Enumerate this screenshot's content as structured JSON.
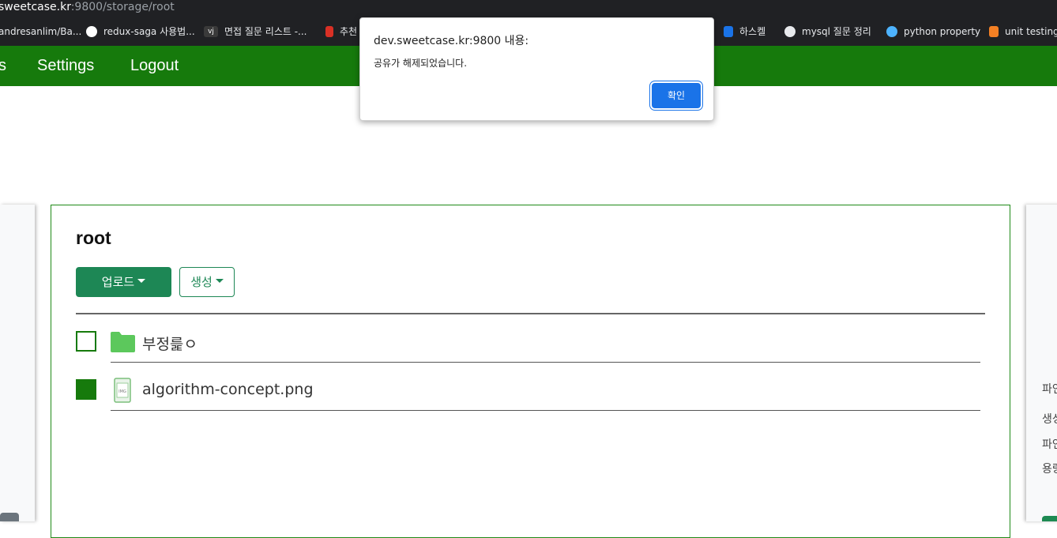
{
  "browser": {
    "url_host": "sweetcase.kr",
    "url_path": ":9800/storage/root",
    "bookmarks": [
      {
        "label": "andresanlim/Ba...",
        "icon": "github-icon",
        "color": "#202124"
      },
      {
        "label": "redux-saga 사용법...",
        "icon": "globe-icon",
        "color": "#ffffff"
      },
      {
        "label": "면접 질문 리스트 -...",
        "icon": "velog-icon",
        "color": "#202124"
      },
      {
        "label": "추천",
        "icon": "bookmark-red-icon",
        "color": "#d93025"
      },
      {
        "label": "하스켈",
        "icon": "w-icon",
        "color": "#1a73e8"
      },
      {
        "label": "mysql 질문 정리",
        "icon": "cloud-icon",
        "color": "#e8eaed"
      },
      {
        "label": "python property",
        "icon": "python-icon",
        "color": "#4db3ff"
      },
      {
        "label": "unit testing",
        "icon": "stackoverflow-icon",
        "color": "#f48024"
      }
    ]
  },
  "nav": {
    "items": [
      "s",
      "Settings",
      "Logout"
    ],
    "color": "#167a0c"
  },
  "main": {
    "title": "root",
    "upload_label": "업로드",
    "create_label": "생성",
    "files": [
      {
        "name": "부정릁ㅇ",
        "type": "folder",
        "checked": false,
        "icon": "folder-icon"
      },
      {
        "name": "algorithm-concept.png",
        "type": "image",
        "checked": true,
        "icon": "image-file-icon"
      }
    ]
  },
  "right_panel": {
    "lines": [
      "파인",
      "생성",
      "파인",
      "용량"
    ]
  },
  "dialog": {
    "title": "dev.sweetcase.kr:9800 내용:",
    "message": "공유가 해제되었습니다.",
    "ok_label": "확인"
  }
}
